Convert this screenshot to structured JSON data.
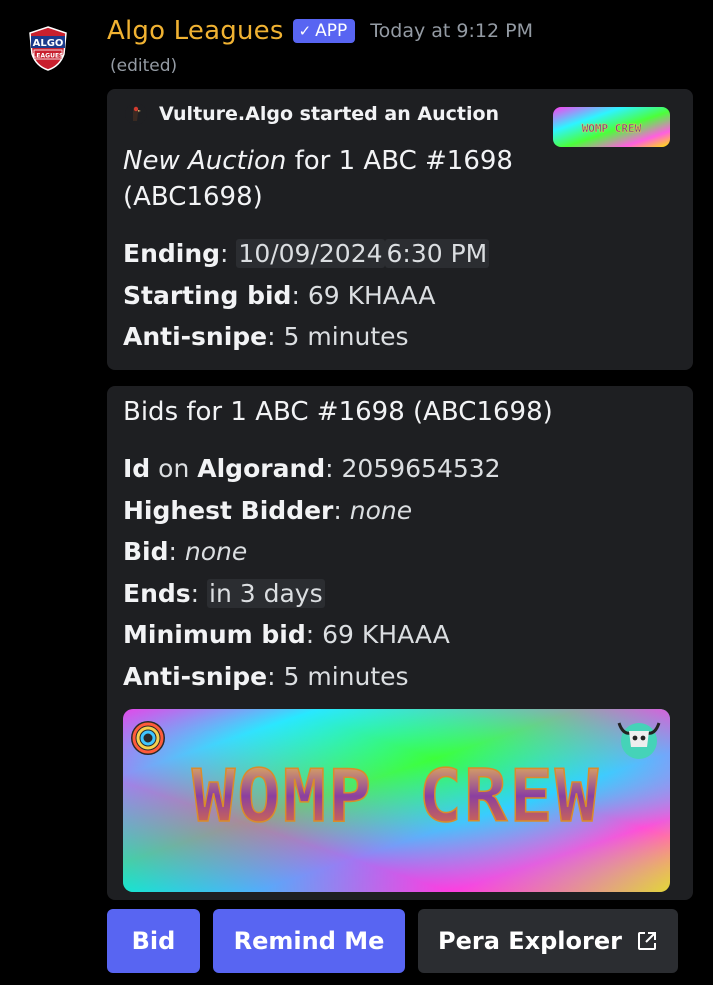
{
  "message": {
    "bot_name": "Algo Leagues",
    "app_badge": "APP",
    "timestamp": "Today at 9:12 PM",
    "edited": "(edited)",
    "avatar_text_top": "ALGO",
    "avatar_text_bottom": "LEAGUES",
    "avatar_icon": "algo-leagues-logo"
  },
  "embed1": {
    "author": "Vulture.Algo started an Auction",
    "author_icon": "vulture-avatar",
    "title_italic": "New Auction",
    "title_rest": " for 1 ABC #1698 (ABC1698)",
    "thumbnail_text": "WOMP CREW",
    "fields": {
      "ending_label": "Ending",
      "ending_date": "10/09/2024",
      "ending_time": "6:30 PM",
      "starting_bid_label": "Starting bid",
      "starting_bid_value": "69 KHAAA",
      "anti_snipe_label": "Anti-snipe",
      "anti_snipe_value": "5 minutes"
    }
  },
  "embed2": {
    "title": "Bids for 1 ABC #1698 (ABC1698)",
    "fields": {
      "id_label": "Id",
      "id_on": "on",
      "id_network": "Algorand",
      "id_value": "2059654532",
      "highest_bidder_label": "Highest Bidder",
      "highest_bidder_value": "none",
      "bid_label": "Bid",
      "bid_value": "none",
      "ends_label": "Ends",
      "ends_value": "in 3 days",
      "min_bid_label": "Minimum bid",
      "min_bid_value": "69 KHAAA",
      "anti_snipe_label": "Anti-snipe",
      "anti_snipe_value": "5 minutes"
    },
    "banner_text": "WOMP CREW"
  },
  "buttons": {
    "bid": "Bid",
    "remind": "Remind Me",
    "pera": "Pera Explorer",
    "pera_icon": "external-link-icon"
  },
  "colors": {
    "bot_name": "#f0b232",
    "app_badge": "#5865f2",
    "embed_bg": "#1e1f22",
    "button_primary": "#5865f2",
    "button_secondary": "#2b2d31"
  }
}
